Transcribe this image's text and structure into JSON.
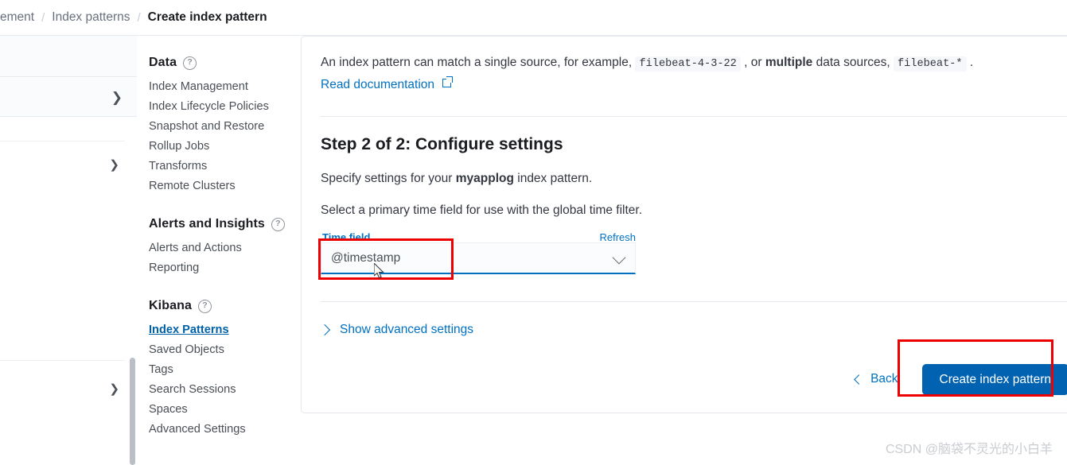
{
  "breadcrumb": {
    "items": [
      "ement",
      "Index patterns",
      "Create index pattern"
    ],
    "separator": "/"
  },
  "settings_nav": {
    "groups": [
      {
        "title": "Data",
        "help_icon": "question-circle-icon",
        "items": [
          "Index Management",
          "Index Lifecycle Policies",
          "Snapshot and Restore",
          "Rollup Jobs",
          "Transforms",
          "Remote Clusters"
        ]
      },
      {
        "title": "Alerts and Insights",
        "help_icon": "question-circle-icon",
        "items": [
          "Alerts and Actions",
          "Reporting"
        ]
      },
      {
        "title": "Kibana",
        "help_icon": "question-circle-icon",
        "items": [
          "Index Patterns",
          "Saved Objects",
          "Tags",
          "Search Sessions",
          "Spaces",
          "Advanced Settings"
        ],
        "active_item": "Index Patterns"
      }
    ]
  },
  "content": {
    "intro_prefix": "An index pattern can match a single source, for example,",
    "intro_code_1": "filebeat-4-3-22",
    "intro_mid_1": ", or",
    "intro_bold": "multiple",
    "intro_mid_2": "data sources,",
    "intro_code_2": "filebeat-*",
    "intro_suffix": ".",
    "doc_link": "Read documentation",
    "doc_link_icon": "external-link-icon",
    "step_title": "Step 2 of 2: Configure settings",
    "specify_prefix": "Specify settings for your",
    "specify_bold": "myapplog",
    "specify_suffix": "index pattern.",
    "select_time_text": "Select a primary time field for use with the global time filter.",
    "time_field_label": "Time field",
    "refresh_label": "Refresh",
    "time_field_value": "@timestamp",
    "time_field_chevron": "chevron-down-icon",
    "advanced_toggle": "Show advanced settings",
    "advanced_toggle_icon": "chevron-right-icon",
    "back_label": "Back",
    "back_icon": "chevron-left-icon",
    "create_label": "Create index pattern"
  },
  "left_panel": {
    "row_chevron_right": "chevron-right-icon",
    "row_chevron_down_1": "chevron-down-icon",
    "row_chevron_down_2": "chevron-down-icon"
  },
  "watermark": "CSDN @脑袋不灵光的小白羊",
  "colors": {
    "link": "#0071c2",
    "primary_button": "#0062b0",
    "annotation": "#ef0000",
    "active_nav": "#0061a6"
  }
}
